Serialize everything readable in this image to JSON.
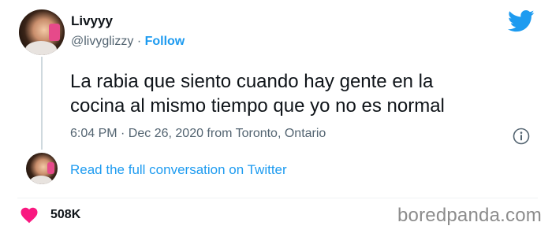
{
  "user": {
    "name": "Livyyy",
    "handle": "@livyglizzy",
    "separator": "·",
    "follow_label": "Follow"
  },
  "tweet": {
    "line1": "La rabia que siento cuando hay gente en la",
    "line2": "cocina al mismo tiempo que yo no es normal",
    "timestamp": "6:04 PM · Dec 26, 2020 from Toronto, Ontario"
  },
  "conversation_link": "Read the full conversation on Twitter",
  "likes_count": "508K",
  "watermark": "boredpanda.com",
  "colors": {
    "accent": "#1d9bf0",
    "text": "#0f1419",
    "muted": "#536471",
    "heart": "#f91880"
  },
  "icons": [
    "twitter-bird-icon",
    "info-icon",
    "heart-icon"
  ]
}
